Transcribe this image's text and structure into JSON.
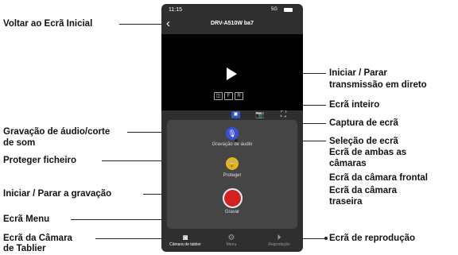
{
  "annotations": {
    "back": "Voltar ao Ecrã Inicial",
    "live": [
      "Iniciar / Parar",
      "transmissão em direto"
    ],
    "fullscreen": "Ecrã inteiro",
    "screenshot": "Captura de ecrã",
    "screen_select": [
      "Seleção de ecrã",
      "Ecrã de ambas as",
      "câmaras",
      "Ecrã da câmara frontal",
      "Ecrã da câmara",
      "traseira"
    ],
    "audio": [
      "Gravação de áudio/corte",
      "de som"
    ],
    "protect": "Proteger ficheiro",
    "record": "Iniciar / Parar a gravação",
    "menu": "Ecrã Menu",
    "dashcam": [
      "Ecrã da Câmara",
      "de Tablier"
    ],
    "playback": "Ecrã de reprodução"
  },
  "phone": {
    "status": {
      "time": "11:15",
      "network": "5G"
    },
    "device_name": "DRV-A510W ba7",
    "camera_buttons": [
      "◫",
      "F",
      "R"
    ],
    "panel": {
      "audio_label": "Gravação de áudio",
      "protect_label": "Proteger",
      "record_label": "Gravar"
    },
    "tabs": [
      {
        "label": "Câmara de tablier",
        "icon": "dashcam-icon",
        "active": true
      },
      {
        "label": "Menu",
        "icon": "gear-icon",
        "active": false
      },
      {
        "label": "Reprodução",
        "icon": "playback-icon",
        "active": false
      }
    ]
  },
  "colors": {
    "audio": "#3b4fd8",
    "protect": "#e3b422",
    "record": "#d42020"
  }
}
